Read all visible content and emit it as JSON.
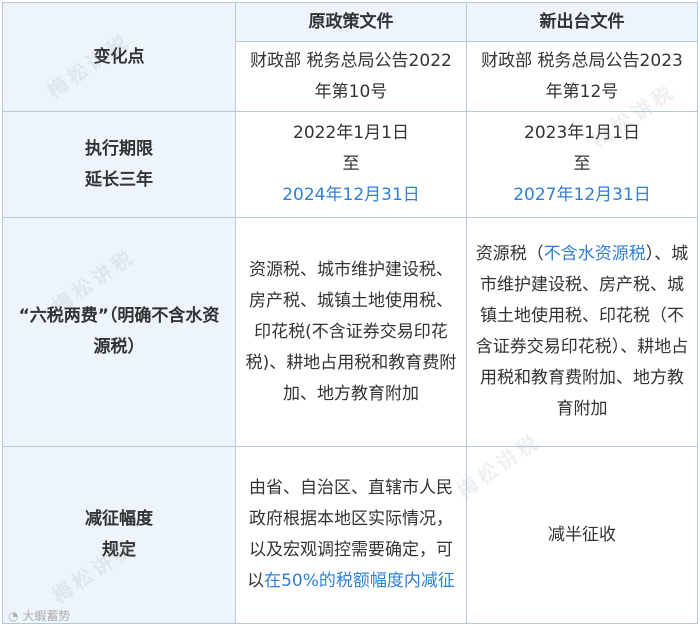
{
  "header": {
    "change_point": "变化点",
    "original": "原政策文件",
    "new": "新出台文件"
  },
  "docs": {
    "original": "财政部 税务总局公告2022年第10号",
    "new": "财政部 税务总局公告2023年第12号"
  },
  "rows": {
    "period": {
      "label_line1": "执行期限",
      "label_line2": "延长三年",
      "original_start": "2022年1月1日",
      "original_to": "至",
      "original_end": "2024年12月31日",
      "new_start": "2023年1月1日",
      "new_to": "至",
      "new_end": "2027年12月31日"
    },
    "taxes": {
      "label": "“六税两费”（明确不含水资源税）",
      "original": "资源税、城市维护建设税、房产税、城镇土地使用税、印花税(不含证券交易印花税)、耕地占用税和教育费附加、地方教育附加",
      "new_prefix": "资源税（",
      "new_highlight": "不含水资源税",
      "new_suffix": "）、城市维护建设税、房产税、城镇土地使用税、印花税（不含证券交易印花税）、耕地占用税和教育费附加、地方教育附加"
    },
    "reduction": {
      "label_line1": "减征幅度",
      "label_line2": "规定",
      "original_prefix": "由省、自治区、直辖市人民政府根据本地区实际情况，以及宏观调控需要确定，可以",
      "original_highlight": "在50%的税额幅度内减征",
      "new": "减半征收"
    }
  },
  "watermark": "梅松讲税",
  "source_mark": "大蝦蓄势"
}
